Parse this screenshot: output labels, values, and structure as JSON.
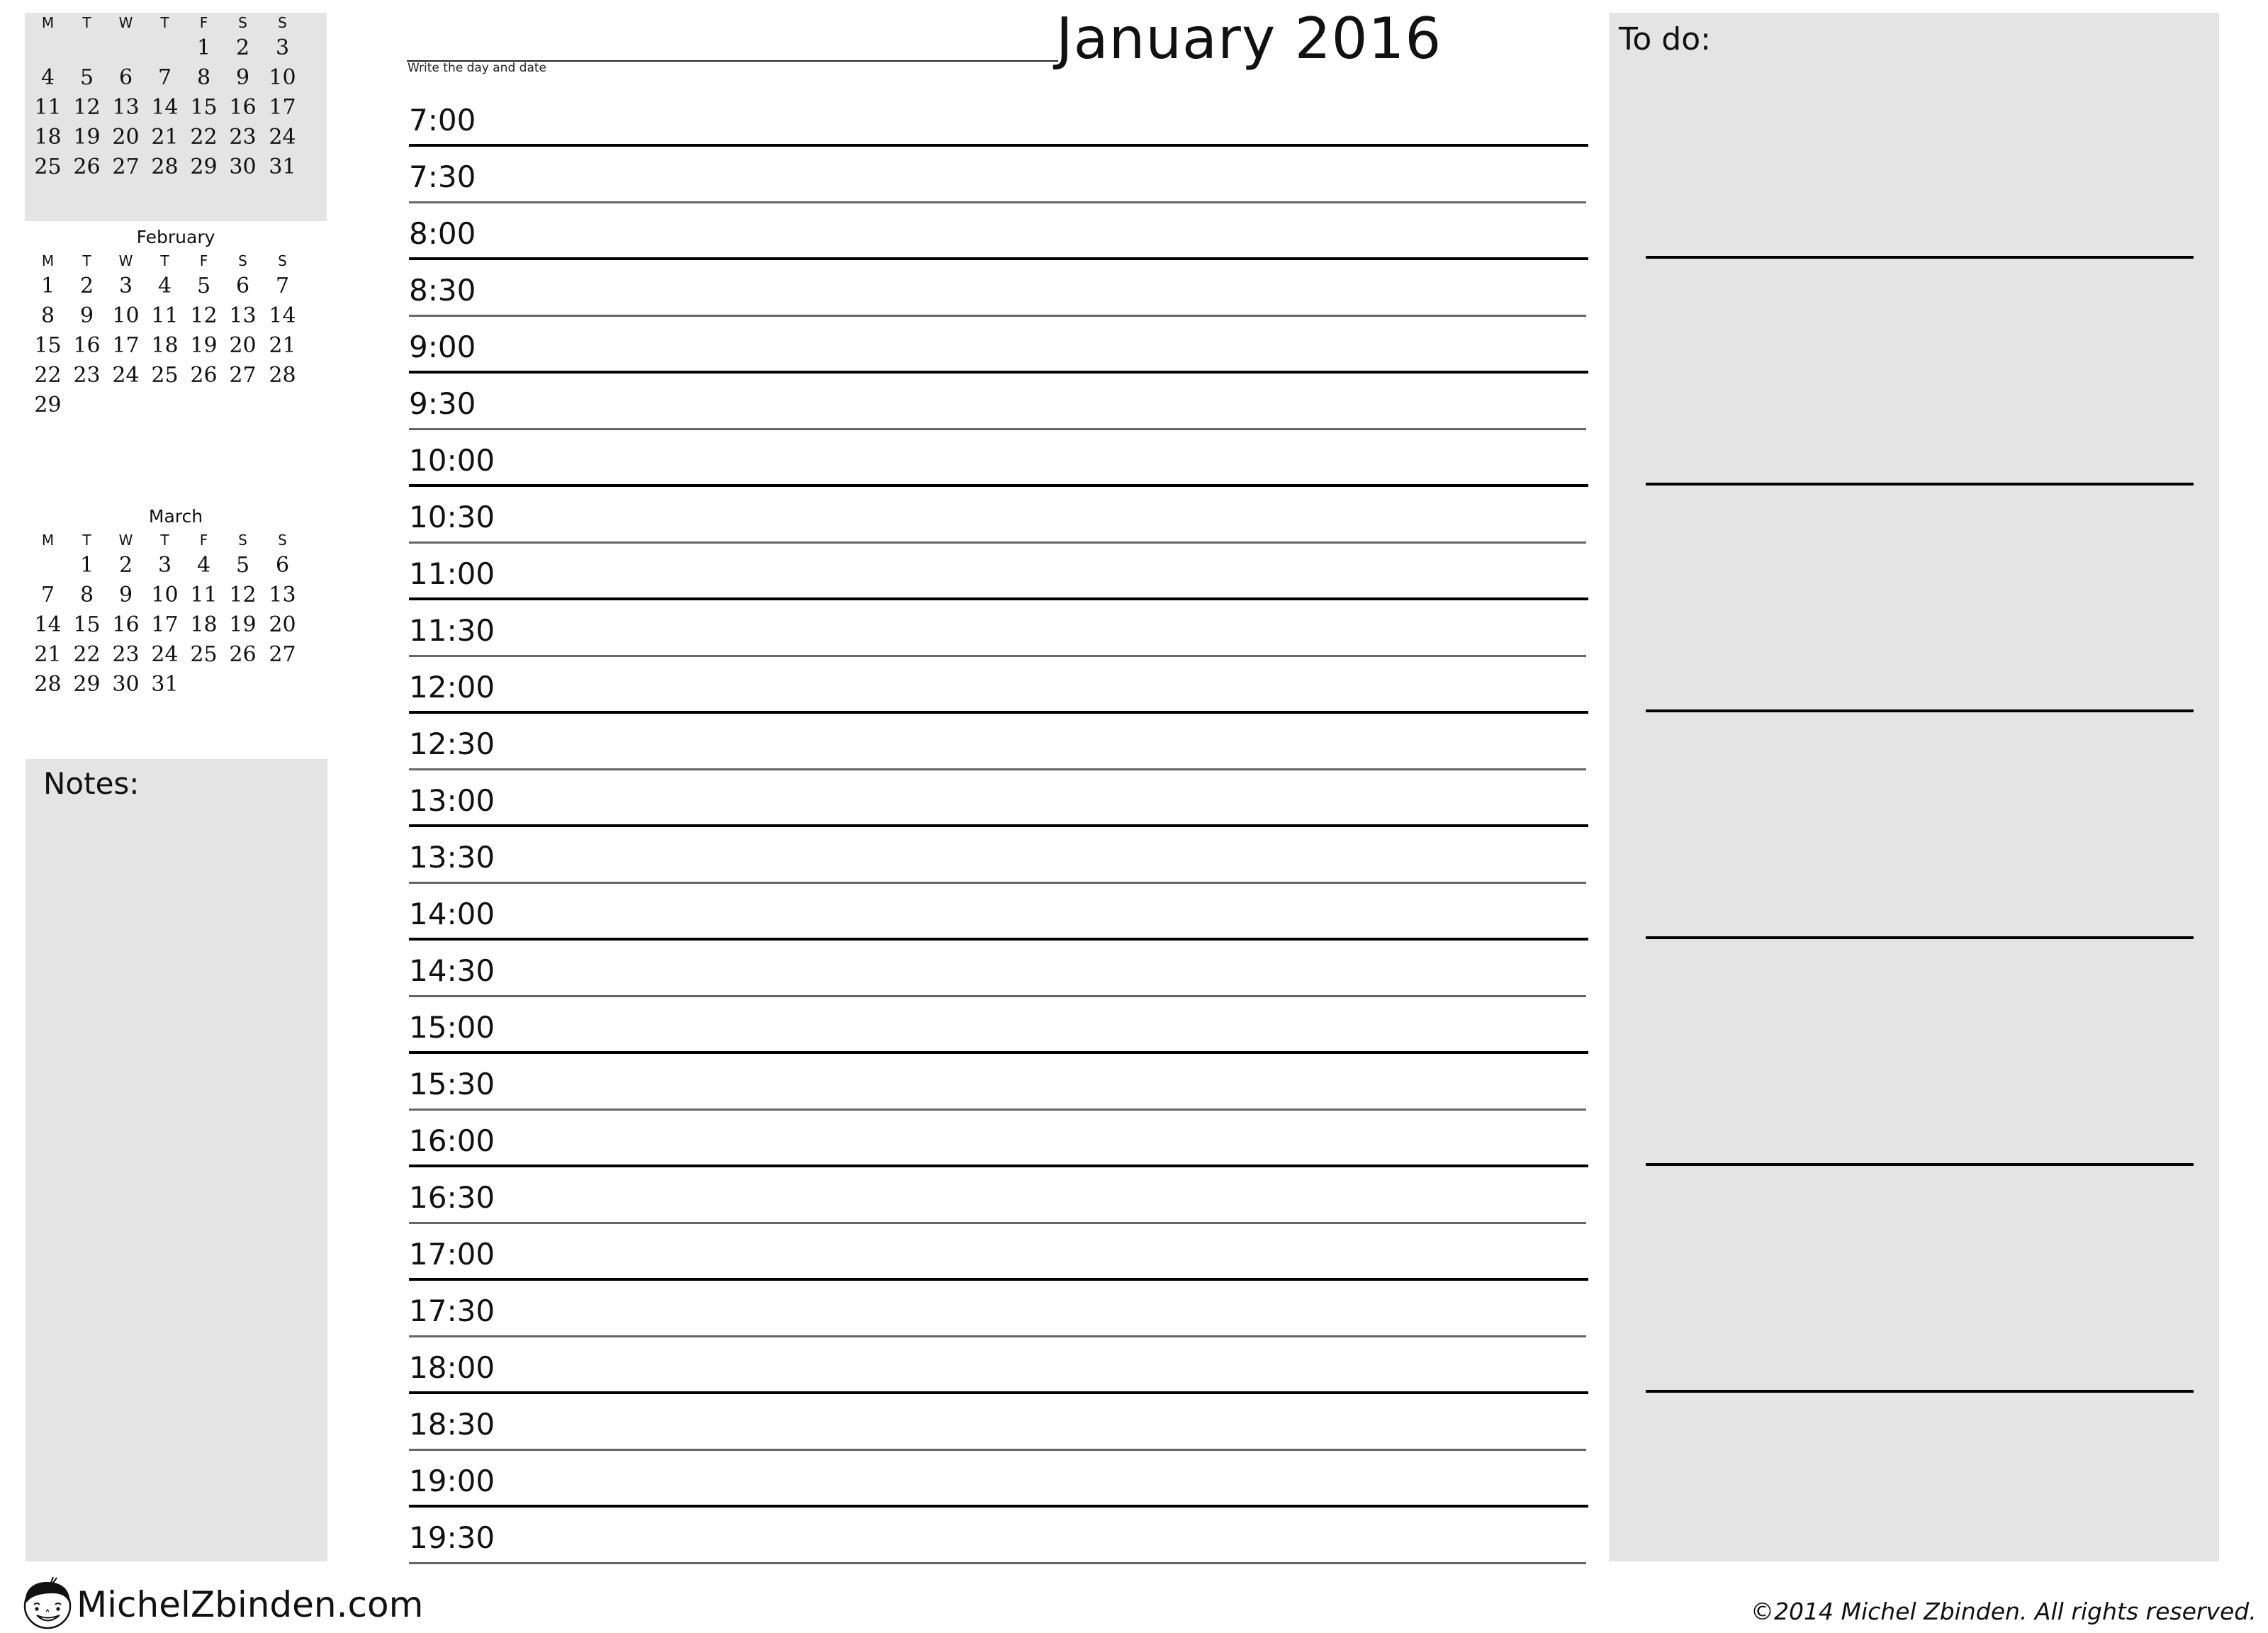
{
  "header": {
    "title": "January 2016",
    "date_hint": "Write the day and date"
  },
  "mini_calendars": [
    {
      "name": "January",
      "show_title": false,
      "weekday_headers": [
        "M",
        "T",
        "W",
        "T",
        "F",
        "S",
        "S"
      ],
      "first_weekday_index": 4,
      "days": 31
    },
    {
      "name": "February",
      "show_title": true,
      "weekday_headers": [
        "M",
        "T",
        "W",
        "T",
        "F",
        "S",
        "S"
      ],
      "first_weekday_index": 0,
      "days": 29
    },
    {
      "name": "March",
      "show_title": true,
      "weekday_headers": [
        "M",
        "T",
        "W",
        "T",
        "F",
        "S",
        "S"
      ],
      "first_weekday_index": 1,
      "days": 31
    }
  ],
  "notes": {
    "label": "Notes:"
  },
  "schedule": {
    "slots": [
      "7:00",
      "7:30",
      "8:00",
      "8:30",
      "9:00",
      "9:30",
      "10:00",
      "10:30",
      "11:00",
      "11:30",
      "12:00",
      "12:30",
      "13:00",
      "13:30",
      "14:00",
      "14:30",
      "15:00",
      "15:30",
      "16:00",
      "16:30",
      "17:00",
      "17:30",
      "18:00",
      "18:30",
      "19:00",
      "19:30"
    ]
  },
  "todo": {
    "label": "To do:",
    "line_count": 6
  },
  "footer": {
    "brand": "MichelZbinden.com",
    "copyright": "©2014 Michel Zbinden. All rights reserved."
  },
  "colors": {
    "panel": "#e4e4e4",
    "hour_line": "#000000",
    "half_hour_line": "#666666"
  }
}
